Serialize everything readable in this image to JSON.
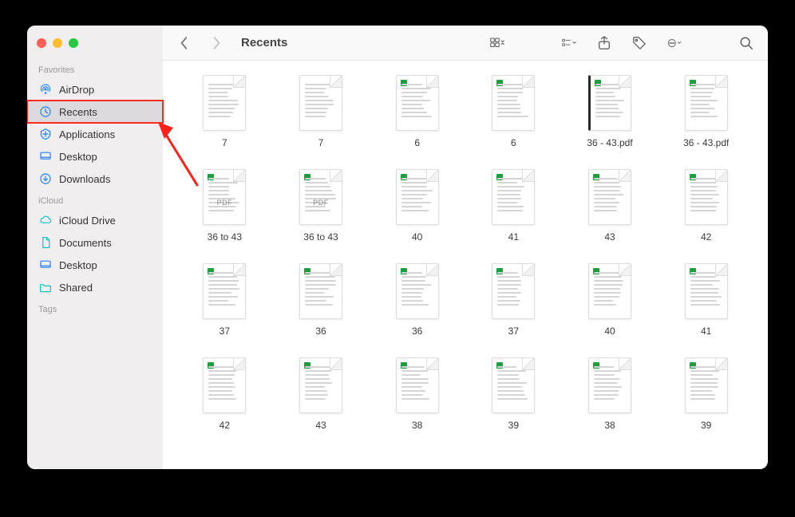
{
  "window": {
    "title": "Recents"
  },
  "traffic": {
    "close": "close",
    "minimize": "minimize",
    "zoom": "zoom"
  },
  "sidebar": {
    "sections": [
      {
        "label": "Favorites",
        "items": [
          {
            "id": "airdrop",
            "label": "AirDrop",
            "icon": "airdrop"
          },
          {
            "id": "recents",
            "label": "Recents",
            "icon": "clock",
            "selected": true,
            "highlighted": true
          },
          {
            "id": "applications",
            "label": "Applications",
            "icon": "app"
          },
          {
            "id": "desktop",
            "label": "Desktop",
            "icon": "desktop"
          },
          {
            "id": "downloads",
            "label": "Downloads",
            "icon": "download"
          }
        ]
      },
      {
        "label": "iCloud",
        "items": [
          {
            "id": "iclouddrive",
            "label": "iCloud Drive",
            "icon": "cloud"
          },
          {
            "id": "documents",
            "label": "Documents",
            "icon": "doc"
          },
          {
            "id": "desktop2",
            "label": "Desktop",
            "icon": "desktop"
          },
          {
            "id": "shared",
            "label": "Shared",
            "icon": "folder"
          }
        ]
      },
      {
        "label": "Tags",
        "items": []
      }
    ]
  },
  "toolbar": {
    "back": "Back",
    "forward": "Forward",
    "view_icons": "Icon view",
    "group": "Group",
    "share": "Share",
    "tags": "Edit Tags",
    "actions": "Actions",
    "search": "Search"
  },
  "files": [
    {
      "name": "7",
      "variant": "plain"
    },
    {
      "name": "7",
      "variant": "plain"
    },
    {
      "name": "6",
      "variant": "mixed"
    },
    {
      "name": "6",
      "variant": "mixed"
    },
    {
      "name": "36 - 43.pdf",
      "variant": "dark"
    },
    {
      "name": "36 - 43.pdf",
      "variant": "green"
    },
    {
      "name": "36 to 43",
      "variant": "pdf"
    },
    {
      "name": "36 to 43",
      "variant": "pdf"
    },
    {
      "name": "40",
      "variant": "green"
    },
    {
      "name": "41",
      "variant": "green"
    },
    {
      "name": "43",
      "variant": "green"
    },
    {
      "name": "42",
      "variant": "green"
    },
    {
      "name": "37",
      "variant": "green"
    },
    {
      "name": "36",
      "variant": "green"
    },
    {
      "name": "36",
      "variant": "green"
    },
    {
      "name": "37",
      "variant": "green"
    },
    {
      "name": "40",
      "variant": "green"
    },
    {
      "name": "41",
      "variant": "green"
    },
    {
      "name": "42",
      "variant": "green"
    },
    {
      "name": "43",
      "variant": "green"
    },
    {
      "name": "38",
      "variant": "green"
    },
    {
      "name": "39",
      "variant": "green"
    },
    {
      "name": "38",
      "variant": "green"
    },
    {
      "name": "39",
      "variant": "green"
    }
  ]
}
